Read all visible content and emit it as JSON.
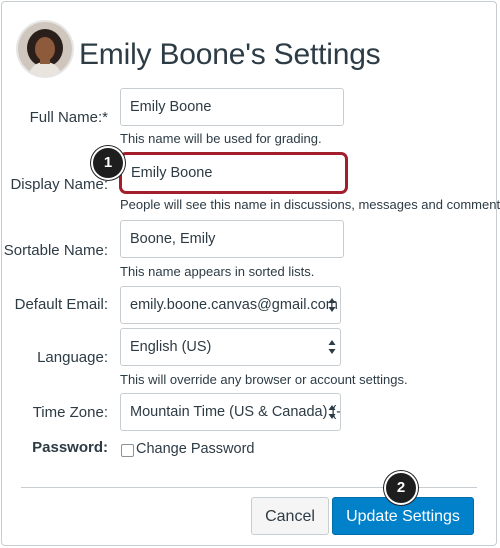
{
  "page": {
    "title": "Emily Boone's Settings"
  },
  "form": {
    "full_name": {
      "label": "Full Name:*",
      "value": "Emily Boone",
      "hint": "This name will be used for grading."
    },
    "display_name": {
      "label": "Display Name:",
      "value": "Emily Boone",
      "hint": "People will see this name in discussions, messages and comments."
    },
    "sortable_name": {
      "label": "Sortable Name:",
      "value": "Boone, Emily",
      "hint": "This name appears in sorted lists."
    },
    "default_email": {
      "label": "Default Email:",
      "value": "emily.boone.canvas@gmail.com"
    },
    "language": {
      "label": "Language:",
      "value": "English (US)",
      "hint": "This will override any browser or account settings."
    },
    "time_zone": {
      "label": "Time Zone:",
      "value": "Mountain Time (US & Canada) (-"
    },
    "password": {
      "label": "Password:",
      "checkbox_label": "Change Password",
      "checked": false
    }
  },
  "actions": {
    "cancel_label": "Cancel",
    "update_label": "Update Settings"
  },
  "callouts": {
    "one": "1",
    "two": "2"
  },
  "colors": {
    "primary": "#0081ca",
    "highlight": "#a11e2a",
    "text": "#2d3b45"
  },
  "icons": {
    "avatar": "user-avatar",
    "select_arrows": "select-arrows-icon"
  }
}
